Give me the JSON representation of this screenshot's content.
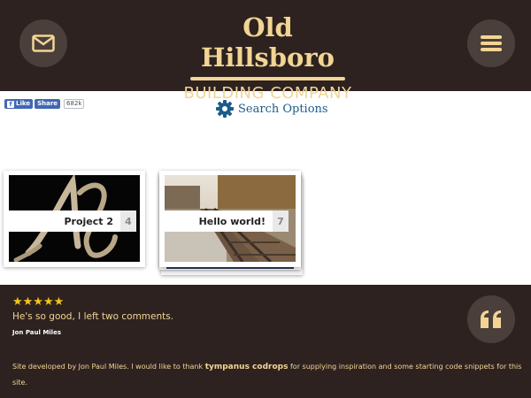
{
  "header": {
    "logo_top": "Old Hillsboro",
    "logo_bottom": "BUILDING COMPANY",
    "mail_icon": "mail-icon",
    "menu_icon": "hamburger-menu-icon"
  },
  "social": {
    "like_label": "Like",
    "share_label": "Share",
    "count": "682k"
  },
  "search": {
    "label": "Search Options",
    "icon": "gear-icon"
  },
  "posts": [
    {
      "title": "Project 2",
      "count": "4"
    },
    {
      "title": "Hello world!",
      "count": "7"
    }
  ],
  "testimonial": {
    "rating": 5,
    "stars": "★★★★★",
    "quote": "He's so good, I left two comments.",
    "author": "Jon Paul Miles",
    "icon": "quote-icon"
  },
  "credits": {
    "prefix": "Site developed by Jon Paul Miles. I would like to thank ",
    "link": "tympanus codrops",
    "suffix": " for supplying inspiration and some starting code snippets for this site."
  },
  "colors": {
    "dark_brown": "#2d2220",
    "gold": "#f2d594",
    "star": "#f6c31c",
    "search_blue": "#1b5c8a",
    "facebook_blue": "#4267b2"
  }
}
